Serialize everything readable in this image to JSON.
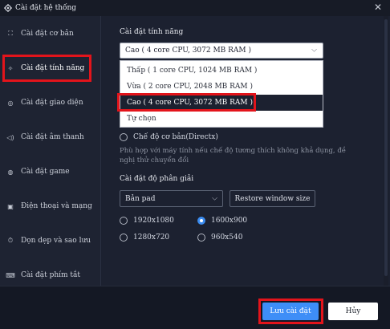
{
  "window": {
    "title": "Cài đặt hệ thống",
    "close_glyph": "✕"
  },
  "sidebar": {
    "items": [
      {
        "label": "Cài đặt cơ bản",
        "icon": "⛶",
        "icon_name": "sliders-icon"
      },
      {
        "label": "Cài đặt tính năng",
        "icon": "✧",
        "icon_name": "performance-icon",
        "active": true
      },
      {
        "label": "Cài đặt giao diện",
        "icon": "◎",
        "icon_name": "display-icon"
      },
      {
        "label": "Cài đặt âm thanh",
        "icon": "◁)",
        "icon_name": "sound-icon"
      },
      {
        "label": "Cài đặt game",
        "icon": "◍",
        "icon_name": "game-icon"
      },
      {
        "label": "Điện thoại và mạng",
        "icon": "▣",
        "icon_name": "phone-icon"
      },
      {
        "label": "Dọn dẹp và sao lưu",
        "icon": "⏱",
        "icon_name": "cleanup-icon"
      },
      {
        "label": "Cài đặt phím tắt",
        "icon": "⌨",
        "icon_name": "keyboard-icon"
      }
    ]
  },
  "performance": {
    "title": "Cài đặt tính năng",
    "selected": "Cao ( 4 core CPU, 3072 MB RAM )",
    "options": [
      "Thấp ( 1 core CPU, 1024 MB RAM )",
      "Vừa ( 2 core CPU, 2048 MB RAM )",
      "Cao ( 4 core CPU, 3072 MB RAM )",
      "Tự chọn"
    ],
    "chev": "⌵"
  },
  "render_mode": {
    "label": "Chế độ cơ bản(Directx)",
    "description": "Phù hợp với máy tính nếu chế độ tương thích không khả dụng, đề nghị thử chuyển đổi"
  },
  "resolution": {
    "title": "Cài đặt độ phân giải",
    "mode": "Bản pad",
    "restore_label": "Restore window size",
    "options": [
      {
        "label": "1920x1080",
        "checked": false
      },
      {
        "label": "1600x900",
        "checked": true
      },
      {
        "label": "1280x720",
        "checked": false
      },
      {
        "label": "960x540",
        "checked": false
      }
    ]
  },
  "footer": {
    "save_label": "Lưu cài đặt",
    "cancel_label": "Hủy"
  },
  "colors": {
    "accent": "#3e8ef7",
    "highlight": "#e3141b",
    "background": "#1c2130"
  }
}
